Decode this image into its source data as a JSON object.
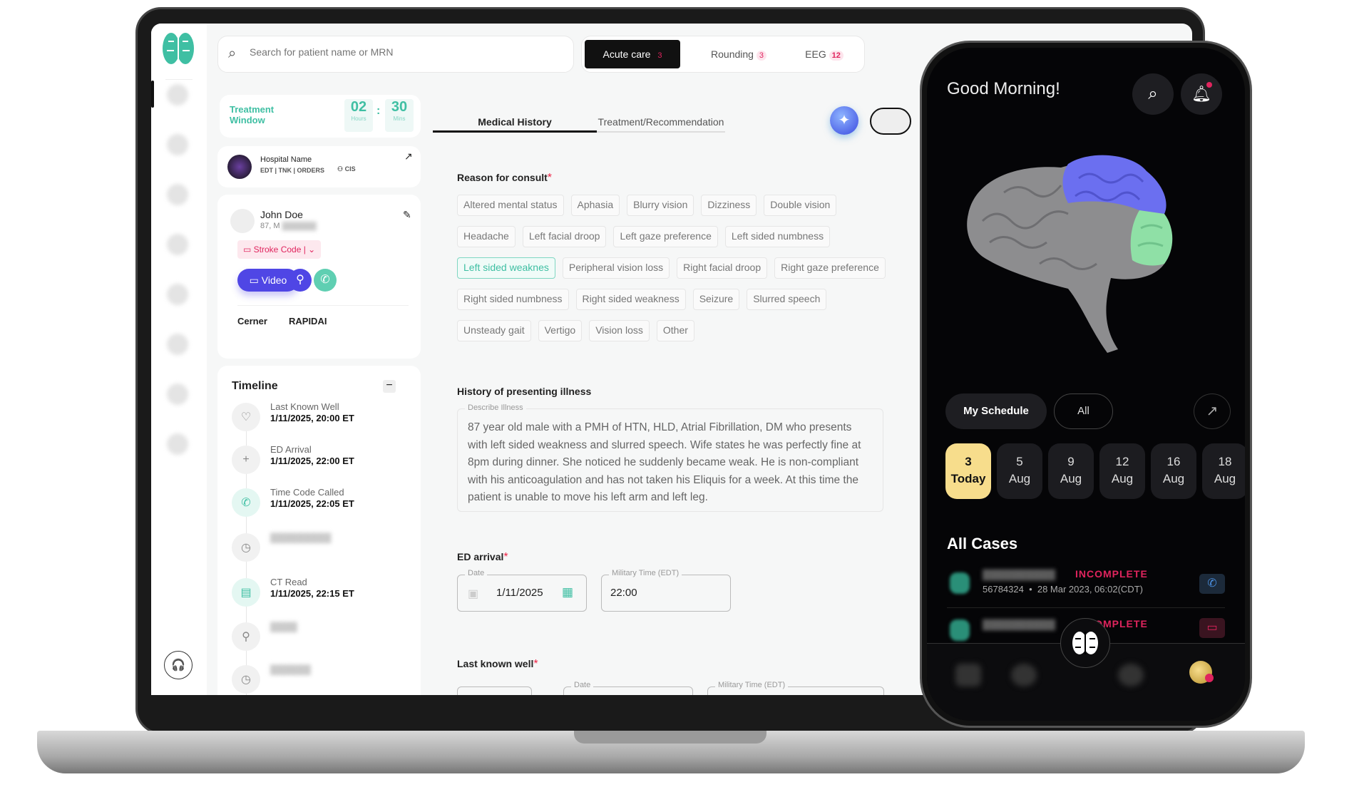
{
  "search": {
    "placeholder": "Search for patient name or MRN"
  },
  "queue_tabs": [
    {
      "label": "Acute care",
      "count": "3"
    },
    {
      "label": "Rounding",
      "count": "3"
    },
    {
      "label": "EEG",
      "count": "12"
    }
  ],
  "treatment_window": {
    "label": "Treatment Window",
    "hours": "02",
    "hours_label": "Hours",
    "mins": "30",
    "mins_label": "Mins"
  },
  "hospital": {
    "name": "Hospital Name",
    "links": "EDT | TNK | ORDERS",
    "cis": "CIS"
  },
  "patient": {
    "name": "John Doe",
    "age_sex": "87, M",
    "stroke_code": "Stroke Code",
    "video_label": "Video",
    "integrations": [
      "Cerner",
      "RAPIDAI"
    ]
  },
  "timeline": {
    "title": "Timeline",
    "items": [
      {
        "label": "Last Known Well",
        "datetime": "1/11/2025, 20:00 ET",
        "icon": "heart-icon"
      },
      {
        "label": "ED Arrival",
        "datetime": "1/11/2025, 22:00 ET",
        "icon": "plus-icon"
      },
      {
        "label": "Time Code Called",
        "datetime": "1/11/2025, 22:05 ET",
        "icon": "phone-icon"
      },
      {
        "label": "",
        "datetime": "",
        "icon": "clock-icon"
      },
      {
        "label": "CT Read",
        "datetime": "1/11/2025, 22:15 ET",
        "icon": "ct-icon"
      },
      {
        "label": "",
        "datetime": "",
        "icon": "user-icon"
      },
      {
        "label": "",
        "datetime": "",
        "icon": "clock-icon"
      }
    ]
  },
  "main_tabs": [
    {
      "label": "Medical History",
      "active": true
    },
    {
      "label": "Treatment/Recommendation",
      "active": false
    }
  ],
  "reason": {
    "label": "Reason for consult",
    "options": [
      "Altered mental status",
      "Aphasia",
      "Blurry vision",
      "Dizziness",
      "Double vision",
      "Headache",
      "Left facial droop",
      "Left gaze preference",
      "Left sided numbness",
      "Left sided weaknes",
      "Peripheral vision loss",
      "Right facial droop",
      "Right gaze preference",
      "Right sided numbness",
      "Right sided weakness",
      "Seizure",
      "Slurred speech",
      "Unsteady gait",
      "Vertigo",
      "Vision loss",
      "Other"
    ],
    "selected": "Left sided weaknes"
  },
  "history": {
    "label": "History of presenting illness",
    "legend": "Describe Illness",
    "text": "87 year old male with a PMH of HTN, HLD, Atrial Fibrillation, DM who presents with left sided weakness and slurred speech. Wife states he was perfectly fine at 8pm during dinner. She noticed he suddenly became weak. He is non-compliant with his anticoagulation and has not taken his Eliquis for a week. At this time the patient is unable to move his left arm and left leg."
  },
  "ed_arrival": {
    "label": "ED arrival",
    "date_legend": "Date",
    "date": "1/11/2025",
    "time_legend": "Military Time (EDT)",
    "time": "22:00"
  },
  "last_known_well": {
    "label": "Last known well",
    "date_legend": "Date",
    "time_legend": "Military Time (EDT)"
  },
  "phone": {
    "greeting": "Good Morning!",
    "schedule_tabs": [
      "My Schedule",
      "All"
    ],
    "dates": [
      {
        "day": "3",
        "sub": "Today"
      },
      {
        "day": "5",
        "sub": "Aug"
      },
      {
        "day": "9",
        "sub": "Aug"
      },
      {
        "day": "12",
        "sub": "Aug"
      },
      {
        "day": "16",
        "sub": "Aug"
      },
      {
        "day": "18",
        "sub": "Aug"
      }
    ],
    "cases_title": "All Cases",
    "cases": [
      {
        "status": "INCOMPLETE",
        "meta": "56784324  •  28 Mar 2023, 06:02(CDT)"
      },
      {
        "status": "INCOMPLETE",
        "meta": ""
      }
    ]
  },
  "colors": {
    "teal": "#3fbfa3",
    "video": "#4f46e5",
    "alert": "#e0245e",
    "today": "#f7dd8c",
    "brain_blue": "#6b6ff0",
    "brain_green": "#8fe0a6"
  }
}
